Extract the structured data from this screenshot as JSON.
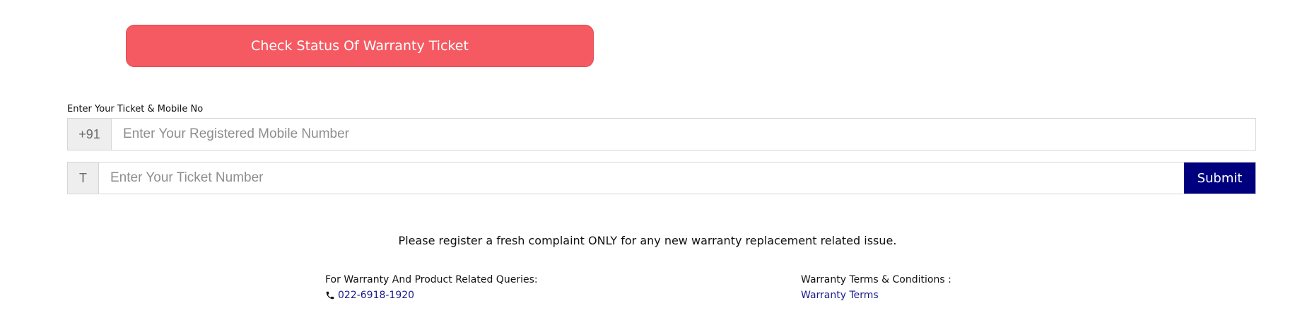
{
  "status_button": {
    "label": "Check Status Of Warranty Ticket"
  },
  "form": {
    "label": "Enter Your Ticket & Mobile No",
    "mobile": {
      "prefix": "+91",
      "placeholder": "Enter Your Registered Mobile Number",
      "value": ""
    },
    "ticket": {
      "prefix": "T",
      "placeholder": "Enter Your Ticket Number",
      "value": ""
    },
    "submit_label": "Submit"
  },
  "notice": "Please register a fresh complaint ONLY for any new warranty replacement related issue.",
  "queries": {
    "heading": "For Warranty And Product Related Queries:",
    "phone": "022-6918-1920",
    "icon": "phone-icon"
  },
  "terms": {
    "heading": "Warranty Terms & Conditions :",
    "link": "Warranty Terms"
  },
  "colors": {
    "status_button": "#f55a62",
    "submit": "#00007f",
    "link": "#1a1a8c"
  }
}
